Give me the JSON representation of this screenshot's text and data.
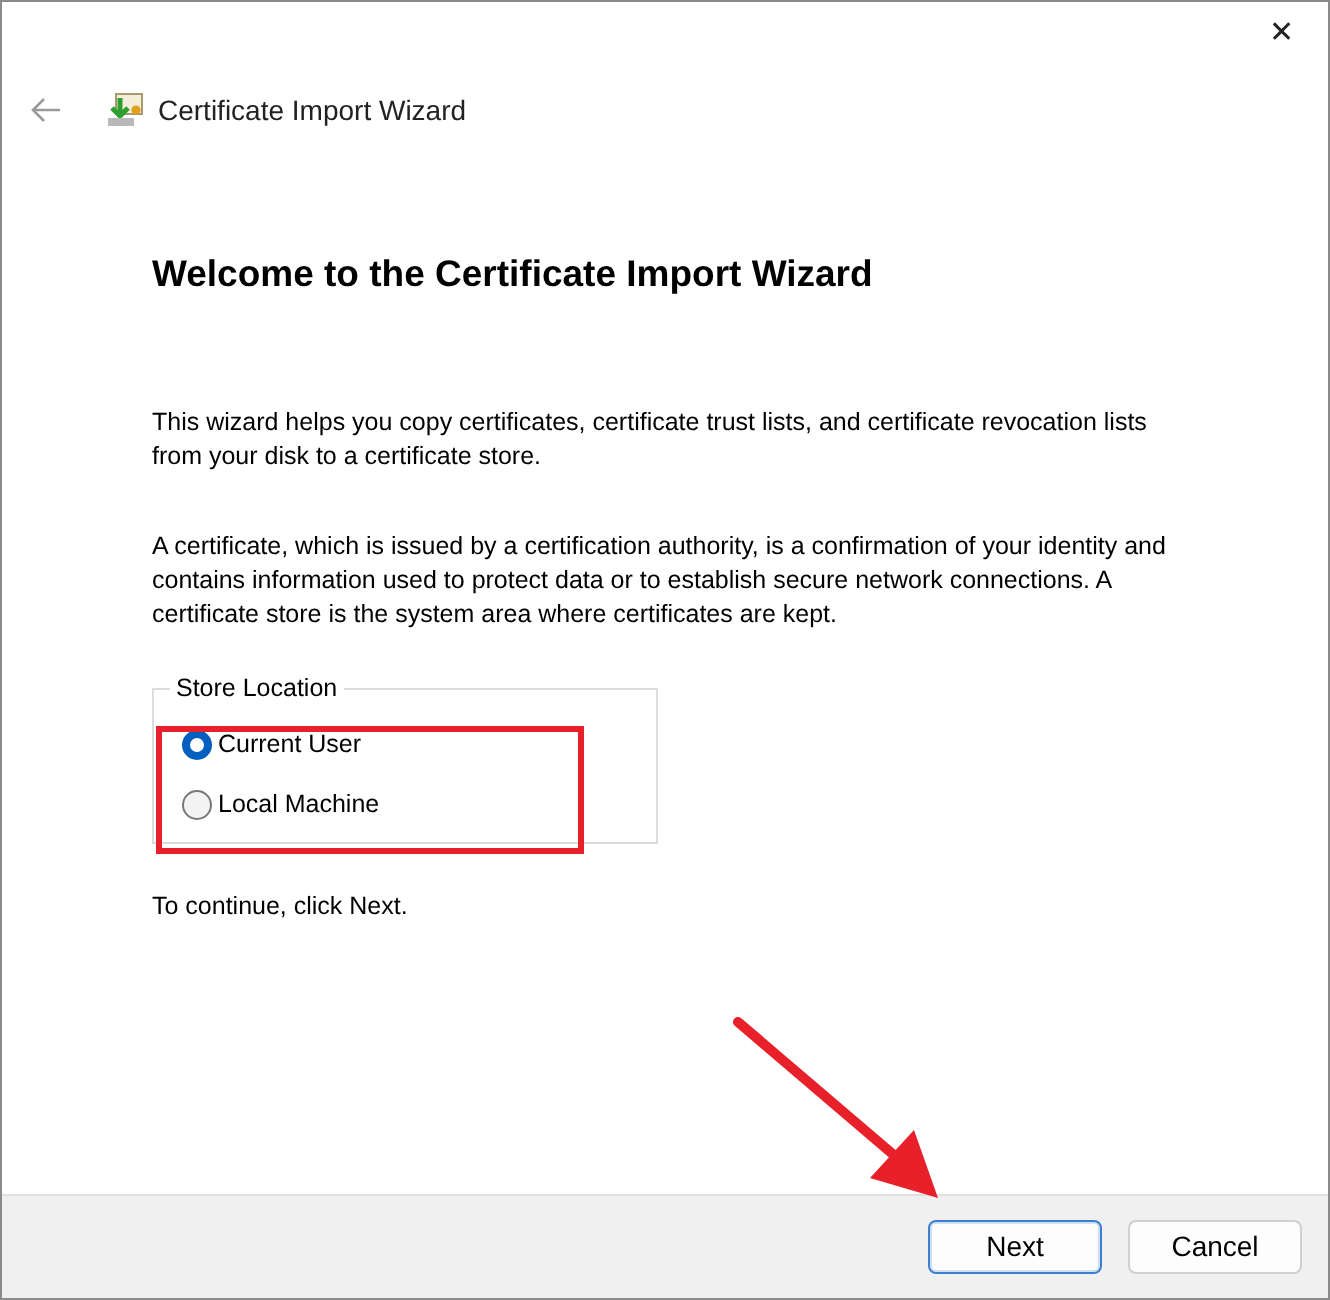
{
  "window": {
    "title": "Certificate Import Wizard",
    "close": "✕"
  },
  "heading": "Welcome to the Certificate Import Wizard",
  "paragraphs": [
    "This wizard helps you copy certificates, certificate trust lists, and certificate revocation lists from your disk to a certificate store.",
    "A certificate, which is issued by a certification authority, is a confirmation of your identity and contains information used to protect data or to establish secure network connections. A certificate store is the system area where certificates are kept."
  ],
  "store_location": {
    "label": "Store Location",
    "options": [
      {
        "label": "Current User",
        "selected": true
      },
      {
        "label": "Local Machine",
        "selected": false
      }
    ]
  },
  "hint": "To continue, click Next.",
  "buttons": [
    {
      "label": "Next",
      "default": true
    },
    {
      "label": "Cancel",
      "default": false
    }
  ]
}
